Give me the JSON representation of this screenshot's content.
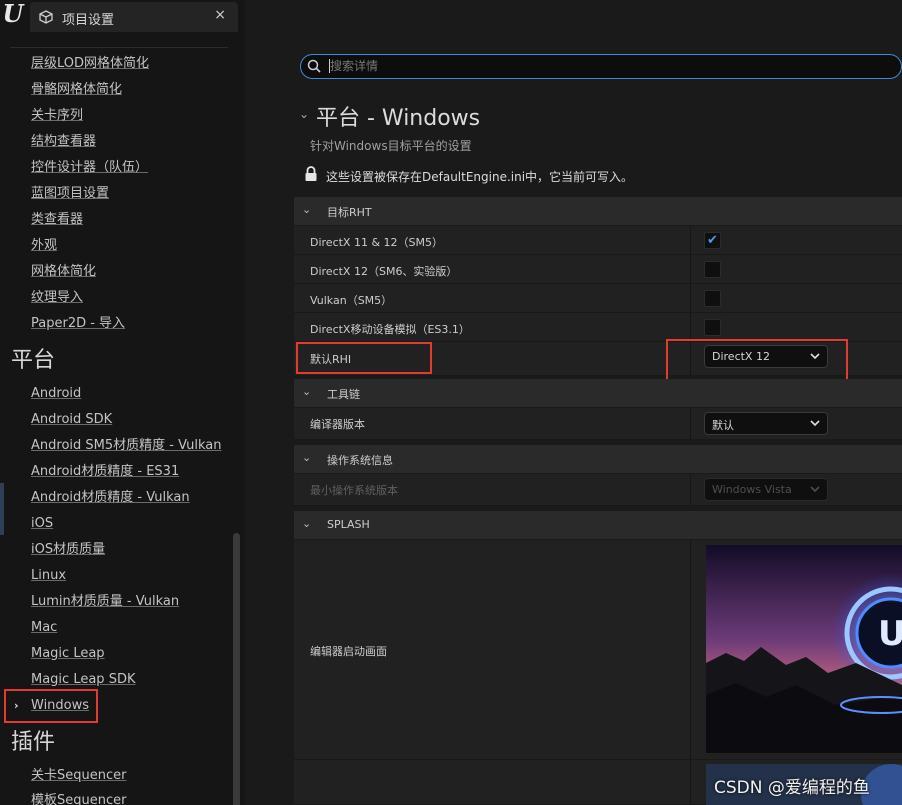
{
  "app": {
    "logo_text": "U",
    "tab_title": "项目设置",
    "tab_close": "×"
  },
  "sidebar": {
    "editor_items": [
      "层级LOD网格体简化",
      "骨骼网格体简化",
      "关卡序列",
      "结构查看器",
      "控件设计器（队伍）",
      "蓝图项目设置",
      "类查看器",
      "外观",
      "网格体简化",
      "纹理导入",
      "Paper2D - 导入"
    ],
    "platforms_header": "平台",
    "platform_items": [
      "Android",
      "Android SDK",
      "Android SM5材质精度 - Vulkan",
      "Android材质精度 - ES31",
      "Android材质精度 - Vulkan",
      "iOS",
      "iOS材质质量",
      "Linux",
      "Lumin材质质量 - Vulkan",
      "Mac",
      "Magic Leap",
      "Magic Leap SDK",
      "Windows"
    ],
    "selected_chevron": "›",
    "plugins_header": "插件",
    "plugin_items": [
      "关卡Sequencer",
      "模板Sequencer"
    ]
  },
  "search": {
    "placeholder": "搜索详情",
    "value": ""
  },
  "page": {
    "title": "平台 - Windows",
    "subtitle": "针对Windows目标平台的设置",
    "config_note": "这些设置被保存在DefaultEngine.ini中，它当前可写入。"
  },
  "sections": {
    "target_rhi": {
      "title": "目标RHT",
      "rows": [
        {
          "label": "DirectX 11 & 12（SM5）",
          "checked": true
        },
        {
          "label": "DirectX 12（SM6、实验版）",
          "checked": false
        },
        {
          "label": "Vulkan（SM5）",
          "checked": false
        },
        {
          "label": "DirectX移动设备模拟（ES3.1）",
          "checked": false
        }
      ],
      "default_rhi_label": "默认RHI",
      "default_rhi_value": "DirectX 12"
    },
    "toolchain": {
      "title": "工具链",
      "compiler_label": "编译器版本",
      "compiler_value": "默认"
    },
    "os_info": {
      "title": "操作系统信息",
      "min_os_label": "最小操作系统版本",
      "min_os_value": "Windows Vista"
    },
    "splash": {
      "title": "SPLASH",
      "editor_splash_label": "编辑器启动画面"
    }
  },
  "colors": {
    "accent": "#3d8ad8",
    "highlight": "#e53a2f",
    "check": "#4d9de8"
  },
  "watermark": "CSDN @爱编程的鱼"
}
